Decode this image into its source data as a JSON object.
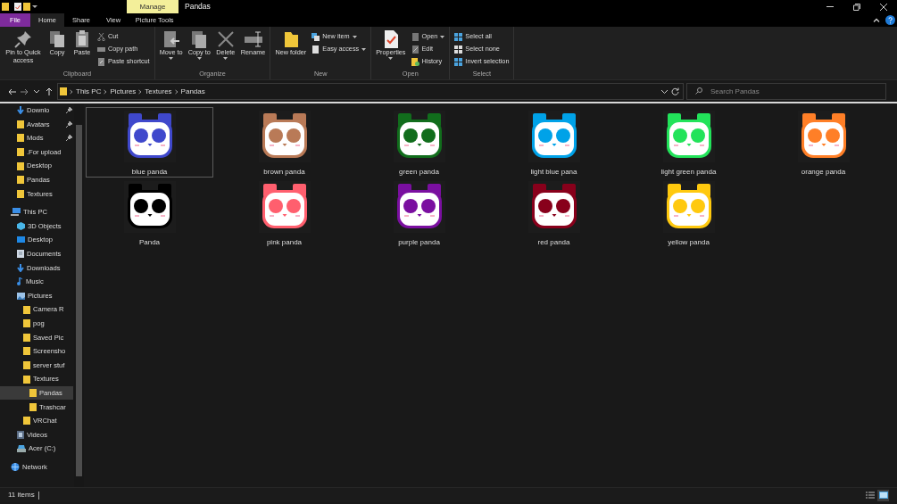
{
  "title_bar": {
    "context_tab": "Manage",
    "title": "Pandas"
  },
  "ribbon_tabs": [
    {
      "label": "File",
      "kind": "file",
      "selected": false
    },
    {
      "label": "Home",
      "kind": "tab",
      "selected": true
    },
    {
      "label": "Share",
      "kind": "tab",
      "selected": false
    },
    {
      "label": "View",
      "kind": "tab",
      "selected": false
    },
    {
      "label": "Picture Tools",
      "kind": "context",
      "selected": false
    }
  ],
  "ribbon_groups": [
    {
      "name": "Clipboard",
      "large": [
        {
          "label": "Pin to Quick access",
          "kind": "pin",
          "dropdown": false
        },
        {
          "label": "Copy",
          "kind": "copy",
          "dropdown": false
        },
        {
          "label": "Paste",
          "kind": "paste",
          "dropdown": false
        }
      ],
      "small": [
        {
          "label": "Cut",
          "kind": "cut",
          "dropdown": false
        },
        {
          "label": "Copy path",
          "kind": "copypath",
          "dropdown": false
        },
        {
          "label": "Paste shortcut",
          "kind": "shortcut",
          "dropdown": false
        }
      ]
    },
    {
      "name": "Organize",
      "large": [
        {
          "label": "Move to",
          "kind": "move",
          "dropdown": true
        },
        {
          "label": "Copy to",
          "kind": "copyto",
          "dropdown": true
        },
        {
          "label": "Delete",
          "kind": "delete",
          "dropdown": true
        },
        {
          "label": "Rename",
          "kind": "rename",
          "dropdown": false
        }
      ]
    },
    {
      "name": "New",
      "large": [
        {
          "label": "New folder",
          "kind": "folder",
          "dropdown": false
        }
      ],
      "small": [
        {
          "label": "New item",
          "kind": "newitem",
          "dropdown": true
        },
        {
          "label": "Easy access",
          "kind": "easy",
          "dropdown": true
        }
      ]
    },
    {
      "name": "Open",
      "large": [
        {
          "label": "Properties",
          "kind": "properties",
          "dropdown": true
        }
      ],
      "small": [
        {
          "label": "Open",
          "kind": "open",
          "dropdown": true
        },
        {
          "label": "Edit",
          "kind": "edit",
          "dropdown": false
        },
        {
          "label": "History",
          "kind": "history",
          "dropdown": false
        }
      ]
    },
    {
      "name": "Select",
      "small": [
        {
          "label": "Select all",
          "kind": "grid",
          "dropdown": false
        },
        {
          "label": "Select none",
          "kind": "gridnone",
          "dropdown": false
        },
        {
          "label": "Invert selection",
          "kind": "grid",
          "dropdown": false
        }
      ]
    }
  ],
  "breadcrumbs": [
    "This PC",
    "Pictures",
    "Textures",
    "Pandas"
  ],
  "search": {
    "placeholder": "Search Pandas"
  },
  "sidebar": {
    "quick_access": [
      {
        "label": "Downlo",
        "kind": "download",
        "pinned": true,
        "selected": false
      },
      {
        "label": "Avatars",
        "kind": "folder",
        "pinned": true,
        "selected": false
      },
      {
        "label": "Mods",
        "kind": "folder",
        "pinned": true,
        "selected": false
      },
      {
        "label": ".For upload",
        "kind": "folder",
        "pinned": false,
        "selected": false
      },
      {
        "label": "Desktop",
        "kind": "folder",
        "pinned": false,
        "selected": false
      },
      {
        "label": "Pandas",
        "kind": "folder",
        "pinned": false,
        "selected": false
      },
      {
        "label": "Textures",
        "kind": "folder",
        "pinned": false,
        "selected": false
      }
    ],
    "tree": [
      {
        "label": "This PC",
        "kind": "pc",
        "selected": false,
        "children": [
          {
            "label": "3D Objects",
            "kind": "cube",
            "selected": false
          },
          {
            "label": "Desktop",
            "kind": "desktop",
            "selected": false
          },
          {
            "label": "Documents",
            "kind": "documents",
            "selected": false
          },
          {
            "label": "Downloads",
            "kind": "download",
            "selected": false
          },
          {
            "label": "Music",
            "kind": "music",
            "selected": false
          },
          {
            "label": "Pictures",
            "kind": "pictures",
            "selected": false,
            "children": [
              {
                "label": "Camera R",
                "kind": "folder",
                "selected": false
              },
              {
                "label": "pog",
                "kind": "folder",
                "selected": false
              },
              {
                "label": "Saved Pic",
                "kind": "folder",
                "selected": false
              },
              {
                "label": "Screensho",
                "kind": "folder",
                "selected": false
              },
              {
                "label": "server stuf",
                "kind": "folder",
                "selected": false
              },
              {
                "label": "Textures",
                "kind": "folder",
                "selected": false,
                "children": [
                  {
                    "label": "Pandas",
                    "kind": "folder",
                    "selected": true
                  },
                  {
                    "label": "Trashcar",
                    "kind": "folder",
                    "selected": false
                  }
                ]
              },
              {
                "label": "VRChat",
                "kind": "folder",
                "selected": false
              }
            ]
          },
          {
            "label": "Videos",
            "kind": "videos",
            "selected": false
          },
          {
            "label": "Acer (C:)",
            "kind": "drive",
            "selected": false
          }
        ]
      },
      {
        "label": "Network",
        "kind": "network",
        "selected": false
      }
    ]
  },
  "files": [
    {
      "label": "blue panda",
      "color": "#3f48cc",
      "selected": true
    },
    {
      "label": "brown panda",
      "color": "#b97a57",
      "selected": false
    },
    {
      "label": "green panda",
      "color": "#116d1c",
      "selected": false
    },
    {
      "label": "light blue pana",
      "color": "#00a2e8",
      "selected": false
    },
    {
      "label": "light green panda",
      "color": "#22e35a",
      "selected": false
    },
    {
      "label": "orange panda",
      "color": "#ff7f27",
      "selected": false
    },
    {
      "label": "Panda",
      "color": "#000000",
      "selected": false
    },
    {
      "label": "pink panda",
      "color": "#ff5f6e",
      "selected": false
    },
    {
      "label": "purple panda",
      "color": "#7a0fa0",
      "selected": false
    },
    {
      "label": "red panda",
      "color": "#88001b",
      "selected": false
    },
    {
      "label": "yellow panda",
      "color": "#ffc90e",
      "selected": false
    }
  ],
  "status_bar": {
    "item_count": "11 items",
    "views": [
      {
        "kind": "details",
        "selected": false
      },
      {
        "kind": "large_icons",
        "selected": true
      }
    ]
  }
}
